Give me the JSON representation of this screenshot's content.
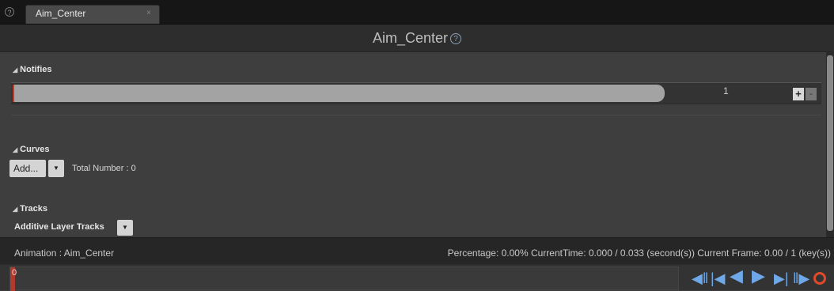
{
  "tab": {
    "title": "Aim_Center",
    "close": "×",
    "help_icon": "?"
  },
  "header": {
    "title": "Aim_Center",
    "help_icon": "?"
  },
  "sections": {
    "notifies": {
      "title": "Notifies",
      "track_number": "1",
      "add": "+",
      "remove": "-"
    },
    "curves": {
      "title": "Curves",
      "add_label": "Add...",
      "total": "Total Number : 0"
    },
    "tracks": {
      "title": "Tracks",
      "additive_label": "Additive Layer Tracks"
    }
  },
  "status": {
    "animation": "Animation :  Aim_Center",
    "info": "Percentage:  0.00%  CurrentTime:  0.000 / 0.033 (second(s))  Current Frame:  0.00 / 1 (key(s))"
  },
  "timeline": {
    "current_frame_label": "0"
  },
  "colors": {
    "play": "#6fa8e8",
    "loop": "#e04a2a",
    "scrub": "#b03a2e"
  },
  "icons": {
    "jump_start": "jump-to-start-icon",
    "step_back": "step-back-icon",
    "play_reverse": "play-reverse-icon",
    "play": "play-icon",
    "step_forward": "step-forward-icon",
    "jump_end": "jump-to-end-icon",
    "loop": "loop-icon"
  }
}
